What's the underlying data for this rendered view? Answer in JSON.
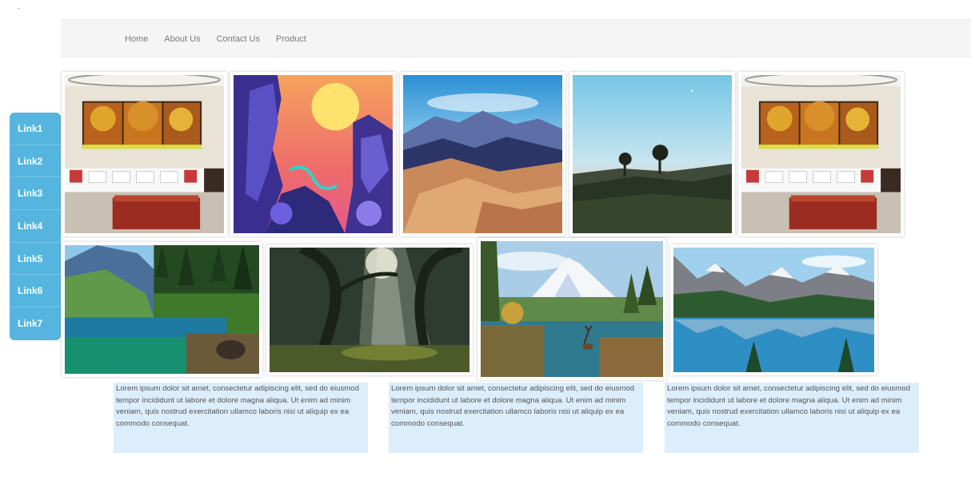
{
  "nav": {
    "items": [
      {
        "label": "Home"
      },
      {
        "label": "About Us"
      },
      {
        "label": "Contact Us"
      },
      {
        "label": "Product"
      }
    ]
  },
  "sidebar": {
    "items": [
      {
        "label": "Link1"
      },
      {
        "label": "Link2"
      },
      {
        "label": "Link3"
      },
      {
        "label": "Link4"
      },
      {
        "label": "Link5"
      },
      {
        "label": "Link6"
      },
      {
        "label": "Link7"
      }
    ],
    "color": "#56b5de"
  },
  "captions": [
    {
      "text": "Lorem ipsum dolor sit amet, consectetur adipiscing elit, sed do eiusmod tempor incididunt ut labore et dolore magna aliqua. Ut enim ad minim veniam, quis nostrud exercitation ullamco laboris nisi ut aliquip ex ea commodo consequat."
    },
    {
      "text": "Lorem ipsum dolor sit amet, consectetur adipiscing elit, sed do eiusmod tempor incididunt ut labore et dolore magna aliqua. Ut enim ad minim veniam, quis nostrud exercitation ullamco laboris nisi ut aliquip ex ea commodo consequat."
    },
    {
      "text": "Lorem ipsum dolor sit amet, consectetur adipiscing elit, sed do eiusmod tempor incididunt ut labore et dolore magna aliqua. Ut enim ad minim veniam, quis nostrud exercitation ullamco laboris nisi ut aliquip ex ea commodo consequat."
    }
  ],
  "gallery": {
    "images": [
      {
        "subject": "living-room-with-tree-painting"
      },
      {
        "subject": "fantasy-cliffs-sunset"
      },
      {
        "subject": "desert-mountains"
      },
      {
        "subject": "twilight-hills"
      },
      {
        "subject": "living-room-with-tree-painting"
      },
      {
        "subject": "mountain-lake-forest"
      },
      {
        "subject": "forest-light-rays"
      },
      {
        "subject": "mountain-painting-deer"
      },
      {
        "subject": "mountain-lake-reflection"
      }
    ]
  },
  "colors": {
    "caption_bg": "#dcedfb",
    "navbar_bg": "#f5f5f5"
  }
}
